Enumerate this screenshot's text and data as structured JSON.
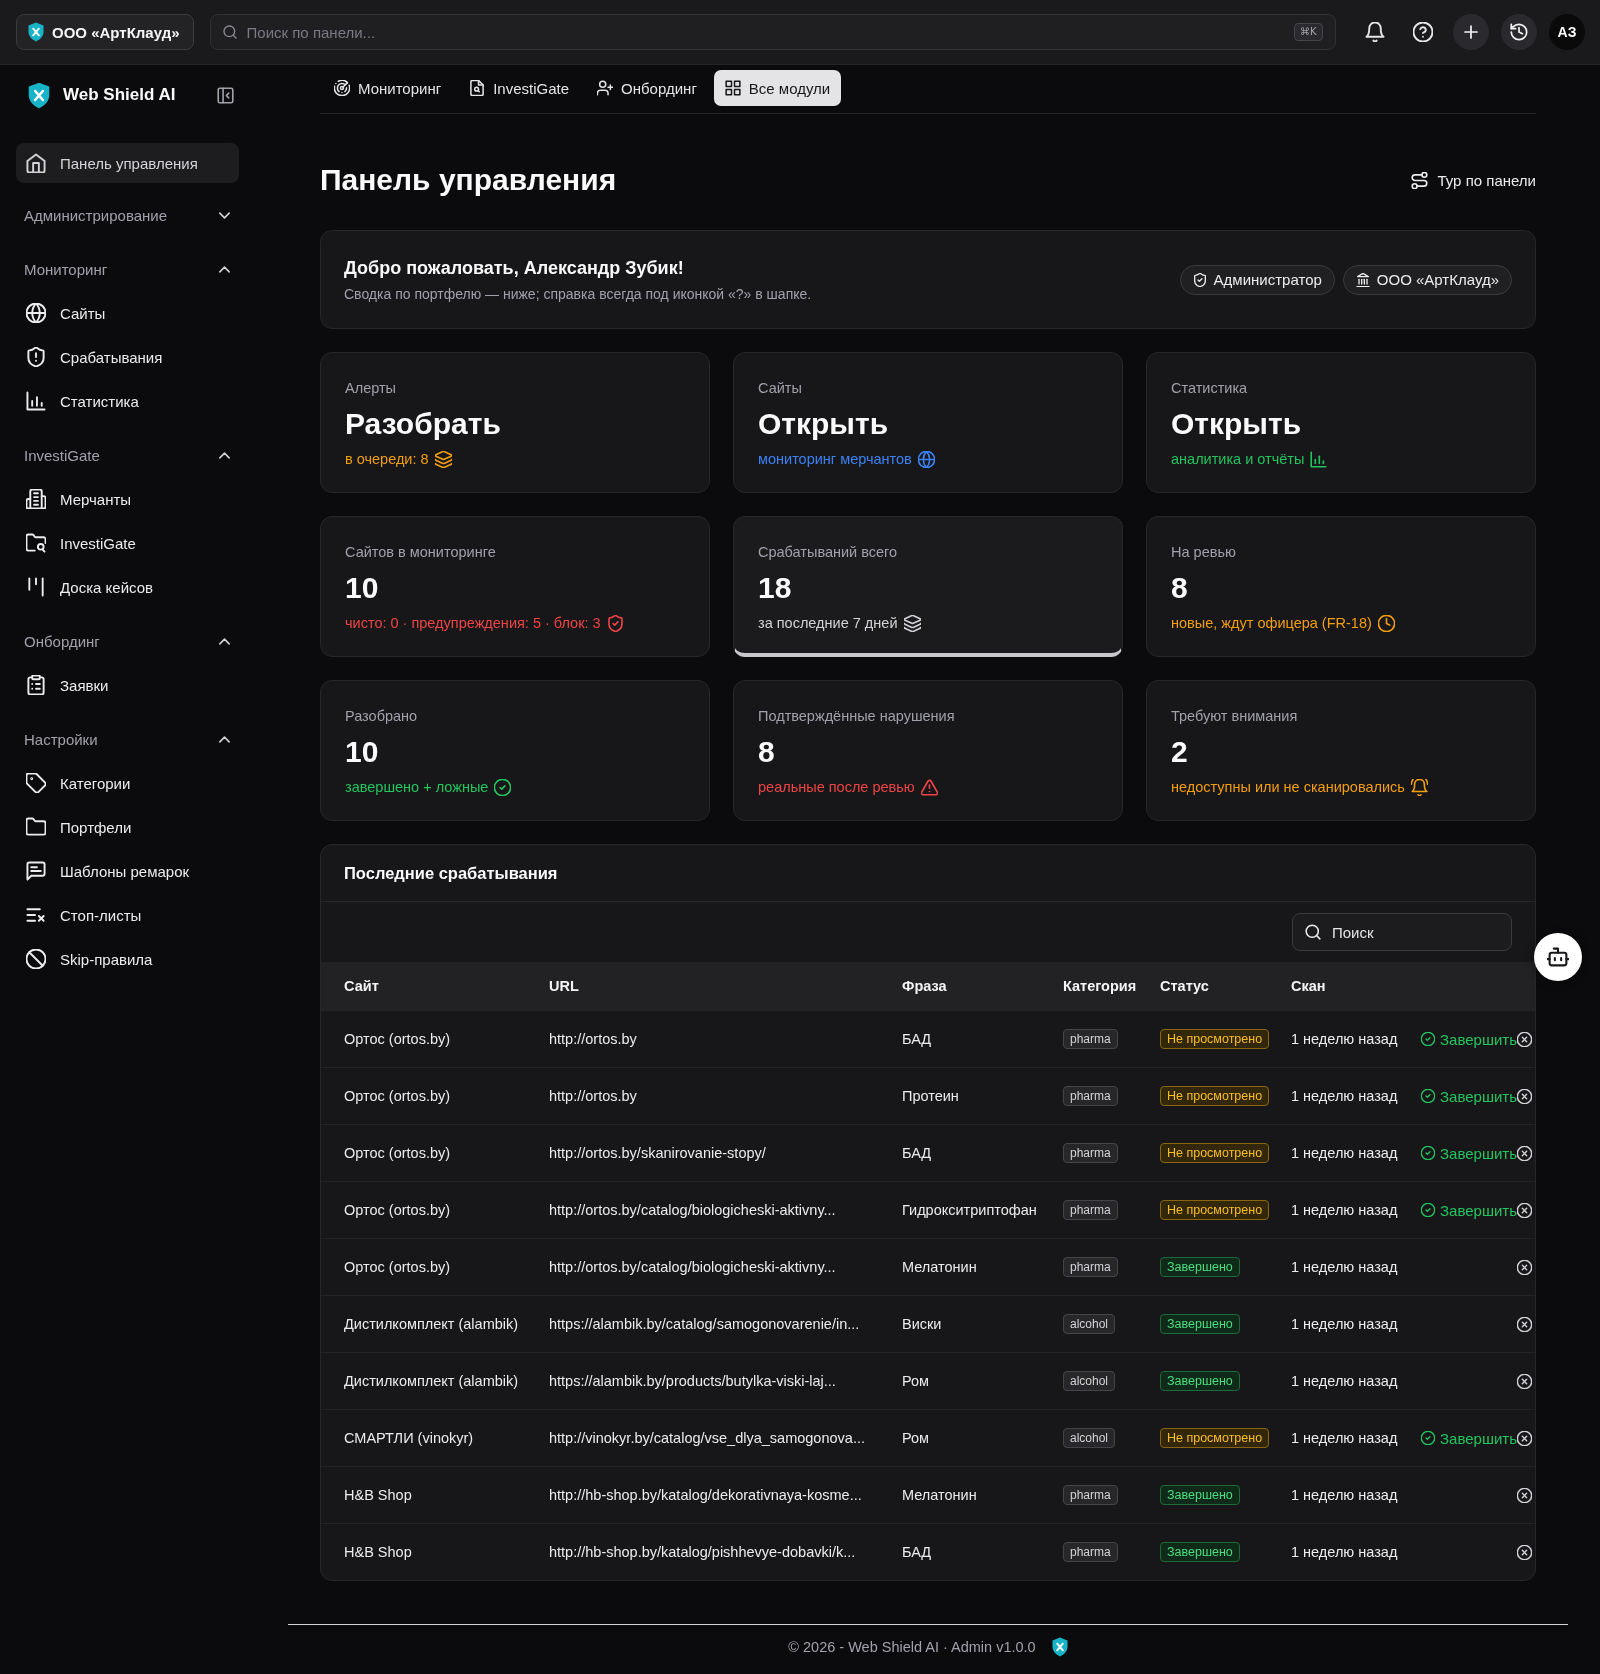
{
  "topbar": {
    "org": "ООО «АртКлауд»",
    "search": {
      "placeholder": "Поиск по панели...",
      "shortcut": "⌘K"
    },
    "avatar": "АЗ"
  },
  "sidebar": {
    "brand": "Web Shield AI",
    "home": {
      "label": "Панель управления",
      "selected": true
    },
    "sections": [
      {
        "title": "Администрирование",
        "expanded": false
      },
      {
        "title": "Мониторинг",
        "expanded": true,
        "items": [
          {
            "label": "Сайты",
            "selected": false
          },
          {
            "label": "Срабатывания",
            "selected": false
          },
          {
            "label": "Статистика",
            "selected": false
          }
        ]
      },
      {
        "title": "InvestiGate",
        "expanded": true,
        "items": [
          {
            "label": "Мерчанты",
            "selected": false
          },
          {
            "label": "InvestiGate",
            "selected": false
          },
          {
            "label": "Доска кейсов",
            "selected": false
          }
        ]
      },
      {
        "title": "Онбординг",
        "expanded": true,
        "items": [
          {
            "label": "Заявки",
            "selected": false
          }
        ]
      },
      {
        "title": "Настройки",
        "expanded": true,
        "items": [
          {
            "label": "Категории",
            "selected": false
          },
          {
            "label": "Портфели",
            "selected": false
          },
          {
            "label": "Шаблоны ремарок",
            "selected": false
          },
          {
            "label": "Стоп-листы",
            "selected": false
          },
          {
            "label": "Skip-правила",
            "selected": false
          }
        ]
      }
    ]
  },
  "tabs": [
    {
      "label": "Мониторинг",
      "selected": false
    },
    {
      "label": "InvestiGate",
      "selected": false
    },
    {
      "label": "Онбординг",
      "selected": false
    },
    {
      "label": "Все модули",
      "selected": true
    }
  ],
  "page": {
    "title": "Панель управления",
    "tour_button": "Тур по панели"
  },
  "welcome": {
    "title": "Добро пожаловать, Александр Зубик!",
    "subtitle": "Сводка по портфелю — ниже; справка всегда под иконкой «?» в шапке.",
    "badges": [
      "Администратор",
      "ООО «АртКлауд»"
    ]
  },
  "cards": [
    {
      "label": "Алерты",
      "value": "Разобрать",
      "note": "в очереди: 8",
      "color": "#f59e0b",
      "highlighted": false
    },
    {
      "label": "Сайты",
      "value": "Открыть",
      "note": "мониторинг мерчантов",
      "color": "#3b82f6",
      "highlighted": false
    },
    {
      "label": "Статистика",
      "value": "Открыть",
      "note": "аналитика и отчёты",
      "color": "#22c55e",
      "highlighted": false
    },
    {
      "label": "Сайтов в мониторинге",
      "value": "10",
      "note": "чисто: 0 · предупреждения: 5 · блок: 3",
      "color": "#ef4444",
      "highlighted": false
    },
    {
      "label": "Срабатываний всего",
      "value": "18",
      "note": "за последние 7 дней",
      "color": "#d4d4d8",
      "highlighted": true
    },
    {
      "label": "На ревью",
      "value": "8",
      "note": "новые, ждут офицера (FR-18)",
      "color": "#f59e0b",
      "highlighted": false
    },
    {
      "label": "Разобрано",
      "value": "10",
      "note": "завершено + ложные",
      "color": "#22c55e",
      "highlighted": false
    },
    {
      "label": "Подтверждённые нарушения",
      "value": "8",
      "note": "реальные после ревью",
      "color": "#ef4444",
      "highlighted": false
    },
    {
      "label": "Требуют внимания",
      "value": "2",
      "note": "недоступны или не сканировались",
      "color": "#f59e0b",
      "highlighted": false
    }
  ],
  "table": {
    "title": "Последние срабатывания",
    "search": {
      "placeholder": "Поиск"
    },
    "columns": [
      "Сайт",
      "URL",
      "Фраза",
      "Категория",
      "Статус",
      "Скан"
    ],
    "rows": [
      {
        "site": "Ортос (ortos.by)",
        "url": "http://ortos.by",
        "phrase": "БАД",
        "category": "pharma",
        "status": {
          "text": "Не просмотрено",
          "kind": "pending"
        },
        "scan": "1 неделю назад",
        "action": "Завершить"
      },
      {
        "site": "Ортос (ortos.by)",
        "url": "http://ortos.by",
        "phrase": "Протеин",
        "category": "pharma",
        "status": {
          "text": "Не просмотрено",
          "kind": "pending"
        },
        "scan": "1 неделю назад",
        "action": "Завершить"
      },
      {
        "site": "Ортос (ortos.by)",
        "url": "http://ortos.by/skanirovanie-stopy/",
        "phrase": "БАД",
        "category": "pharma",
        "status": {
          "text": "Не просмотрено",
          "kind": "pending"
        },
        "scan": "1 неделю назад",
        "action": "Завершить"
      },
      {
        "site": "Ортос (ortos.by)",
        "url": "http://ortos.by/catalog/biologicheski-aktivny...",
        "phrase": "Гидрокситриптофан",
        "category": "pharma",
        "status": {
          "text": "Не просмотрено",
          "kind": "pending"
        },
        "scan": "1 неделю назад",
        "action": "Завершить"
      },
      {
        "site": "Ортос (ortos.by)",
        "url": "http://ortos.by/catalog/biologicheski-aktivny...",
        "phrase": "Мелатонин",
        "category": "pharma",
        "status": {
          "text": "Завершено",
          "kind": "done"
        },
        "scan": "1 неделю назад"
      },
      {
        "site": "Дистилкомплект (alambik)",
        "url": "https://alambik.by/catalog/samogonovarenie/in...",
        "phrase": "Виски",
        "category": "alcohol",
        "status": {
          "text": "Завершено",
          "kind": "done"
        },
        "scan": "1 неделю назад"
      },
      {
        "site": "Дистилкомплект (alambik)",
        "url": "https://alambik.by/products/butylka-viski-laj...",
        "phrase": "Ром",
        "category": "alcohol",
        "status": {
          "text": "Завершено",
          "kind": "done"
        },
        "scan": "1 неделю назад"
      },
      {
        "site": "СМАРТЛИ (vinokyr)",
        "url": "http://vinokyr.by/catalog/vse_dlya_samogonova...",
        "phrase": "Ром",
        "category": "alcohol",
        "status": {
          "text": "Не просмотрено",
          "kind": "pending"
        },
        "scan": "1 неделю назад",
        "action": "Завершить"
      },
      {
        "site": "H&B Shop",
        "url": "http://hb-shop.by/katalog/dekorativnaya-kosme...",
        "phrase": "Мелатонин",
        "category": "pharma",
        "status": {
          "text": "Завершено",
          "kind": "done"
        },
        "scan": "1 неделю назад"
      },
      {
        "site": "H&B Shop",
        "url": "http://hb-shop.by/katalog/pishhevye-dobavki/k...",
        "phrase": "БАД",
        "category": "pharma",
        "status": {
          "text": "Завершено",
          "kind": "done"
        },
        "scan": "1 неделю назад"
      }
    ]
  },
  "footer": {
    "text": "© 2026 - Web Shield AI · Admin v1.0.0"
  }
}
